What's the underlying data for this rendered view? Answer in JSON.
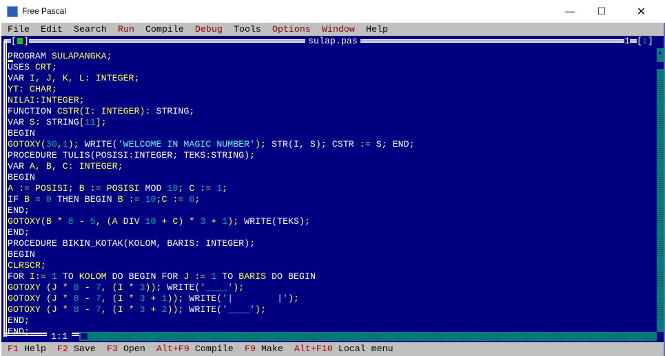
{
  "window": {
    "title": "Free Pascal",
    "minimize": "—",
    "maximize": "☐",
    "close": "✕"
  },
  "menu": [
    "File",
    "Edit",
    "Search",
    "Run",
    "Compile",
    "Debug",
    "Tools",
    "Options",
    "Window",
    "Help"
  ],
  "editor": {
    "filename": "sulap.pas",
    "window_number": "1",
    "cursor_position": "1:1",
    "close_box": "[■]",
    "zoom_box": "[↕]"
  },
  "code": [
    [
      [
        "PROGRAM ",
        "k"
      ],
      [
        "SULAPANGKA;",
        "i"
      ]
    ],
    [
      [
        "USES ",
        "k"
      ],
      [
        "CRT;",
        "i"
      ]
    ],
    [
      [
        "VAR ",
        "k"
      ],
      [
        "I, J, K, L: INTEGER;",
        "i"
      ]
    ],
    [
      [
        "YT: CHAR;",
        "i"
      ]
    ],
    [
      [
        "NILAI:INTEGER;",
        "i"
      ]
    ],
    [
      [
        "FUNCTION ",
        "k"
      ],
      [
        "CSTR(I: INTEGER): ",
        "i"
      ],
      [
        "STRING",
        "k"
      ],
      [
        ";",
        "i"
      ]
    ],
    [
      [
        "VAR ",
        "k"
      ],
      [
        "S: ",
        "i"
      ],
      [
        "STRING",
        "k"
      ],
      [
        "[",
        "i"
      ],
      [
        "11",
        "n"
      ],
      [
        "];",
        "i"
      ]
    ],
    [
      [
        "BEGIN",
        "k"
      ]
    ],
    [
      [
        "GOTOXY(",
        "i"
      ],
      [
        "30",
        "n"
      ],
      [
        ",",
        "i"
      ],
      [
        "1",
        "n"
      ],
      [
        "); ",
        "i"
      ],
      [
        "WRITE(",
        "k"
      ],
      [
        "'WELCOME IN MAGIC NUMBER'",
        "s"
      ],
      [
        "); ",
        "i"
      ],
      [
        "STR(I, S); CSTR := S; ",
        "k"
      ],
      [
        "END",
        "k"
      ],
      [
        ";",
        "i"
      ]
    ],
    [
      [
        "PROCEDURE ",
        "k"
      ],
      [
        "TULIS(POSISI:INTEGER; TEKS:",
        "k"
      ],
      [
        "STRING",
        "k"
      ],
      [
        ");",
        "k"
      ]
    ],
    [
      [
        "VAR ",
        "k"
      ],
      [
        "A, B, C: INTEGER;",
        "i"
      ]
    ],
    [
      [
        "BEGIN",
        "k"
      ]
    ],
    [
      [
        "A := POSISI; B := POSISI ",
        "i"
      ],
      [
        "MOD ",
        "k"
      ],
      [
        "10",
        "n"
      ],
      [
        "; C := ",
        "i"
      ],
      [
        "1",
        "n"
      ],
      [
        ";",
        "i"
      ]
    ],
    [
      [
        "IF ",
        "k"
      ],
      [
        "B = ",
        "i"
      ],
      [
        "0 ",
        "n"
      ],
      [
        "THEN BEGIN ",
        "k"
      ],
      [
        "B := ",
        "i"
      ],
      [
        "10",
        "n"
      ],
      [
        ";C := ",
        "i"
      ],
      [
        "0",
        "n"
      ],
      [
        ";",
        "i"
      ]
    ],
    [
      [
        "END",
        "k"
      ],
      [
        ";",
        "i"
      ]
    ],
    [
      [
        "GOTOXY(B * ",
        "i"
      ],
      [
        "8",
        "n"
      ],
      [
        " - ",
        "i"
      ],
      [
        "5",
        "n"
      ],
      [
        ", (A ",
        "i"
      ],
      [
        "DIV ",
        "k"
      ],
      [
        "10",
        "n"
      ],
      [
        " + C) * ",
        "i"
      ],
      [
        "3",
        "n"
      ],
      [
        " + ",
        "i"
      ],
      [
        "1",
        "n"
      ],
      [
        "); ",
        "i"
      ],
      [
        "WRITE(TEKS);",
        "k"
      ]
    ],
    [
      [
        "END",
        "k"
      ],
      [
        ";",
        "i"
      ]
    ],
    [
      [
        "PROCEDURE ",
        "k"
      ],
      [
        "BIKIN_KOTAK(KOLOM, BARIS: INTEGER);",
        "k"
      ]
    ],
    [
      [
        "BEGIN",
        "k"
      ]
    ],
    [
      [
        "CLRSCR;",
        "i"
      ]
    ],
    [
      [
        "FOR ",
        "k"
      ],
      [
        "I:= ",
        "i"
      ],
      [
        "1 ",
        "n"
      ],
      [
        "TO ",
        "k"
      ],
      [
        "KOLOM ",
        "i"
      ],
      [
        "DO BEGIN FOR ",
        "k"
      ],
      [
        "J := ",
        "i"
      ],
      [
        "1 ",
        "n"
      ],
      [
        "TO ",
        "k"
      ],
      [
        "BARIS ",
        "i"
      ],
      [
        "DO BEGIN",
        "k"
      ]
    ],
    [
      [
        "GOTOXY (J * ",
        "i"
      ],
      [
        "8",
        "n"
      ],
      [
        " - ",
        "i"
      ],
      [
        "7",
        "n"
      ],
      [
        ", (I * ",
        "i"
      ],
      [
        "3",
        "n"
      ],
      [
        ")); ",
        "i"
      ],
      [
        "WRITE(",
        "k"
      ],
      [
        "'____'",
        "s"
      ],
      [
        ");",
        "i"
      ]
    ],
    [
      [
        "GOTOXY (J * ",
        "i"
      ],
      [
        "8",
        "n"
      ],
      [
        " - ",
        "i"
      ],
      [
        "7",
        "n"
      ],
      [
        ", (I * ",
        "i"
      ],
      [
        "3",
        "n"
      ],
      [
        " + ",
        "i"
      ],
      [
        "1",
        "n"
      ],
      [
        ")); ",
        "i"
      ],
      [
        "WRITE(",
        "k"
      ],
      [
        "'|        |'",
        "s"
      ],
      [
        ");",
        "i"
      ]
    ],
    [
      [
        "GOTOXY (J * ",
        "i"
      ],
      [
        "8",
        "n"
      ],
      [
        " - ",
        "i"
      ],
      [
        "7",
        "n"
      ],
      [
        ", (I * ",
        "i"
      ],
      [
        "3",
        "n"
      ],
      [
        " + ",
        "i"
      ],
      [
        "2",
        "n"
      ],
      [
        ")); ",
        "i"
      ],
      [
        "WRITE(",
        "k"
      ],
      [
        "'____'",
        "s"
      ],
      [
        ");",
        "i"
      ]
    ],
    [
      [
        "END",
        "k"
      ],
      [
        ";",
        "i"
      ]
    ],
    [
      [
        "END",
        "k"
      ],
      [
        ";",
        "i"
      ]
    ]
  ],
  "statusbar": [
    {
      "key": "F1",
      "label": "Help"
    },
    {
      "key": "F2",
      "label": "Save"
    },
    {
      "key": "F3",
      "label": "Open"
    },
    {
      "key": "Alt+F9",
      "label": "Compile"
    },
    {
      "key": "F9",
      "label": "Make"
    },
    {
      "key": "Alt+F10",
      "label": "Local menu"
    }
  ],
  "colors": {
    "editor_bg": "#000080",
    "keyword": "#ffffff",
    "identifier": "#ffff55",
    "number": "#00aaaa",
    "string": "#55ffff",
    "menu_bg": "#c0c0c0",
    "hotkey": "#a00000"
  }
}
